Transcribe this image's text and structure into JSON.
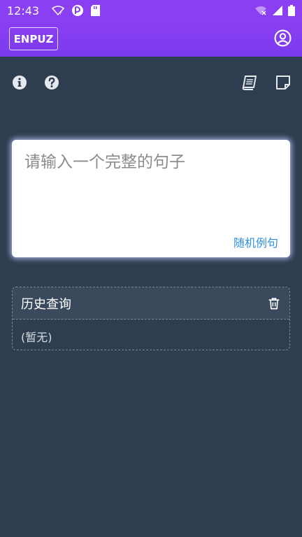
{
  "status_bar": {
    "time": "12:43",
    "icons": [
      "wifi-question-icon",
      "app-notification-icon",
      "sd-card-icon",
      "wifi-off-icon",
      "signal-icon",
      "battery-icon"
    ]
  },
  "app_bar": {
    "logo_text": "ENPUZ",
    "account_icon": "account-circle-icon"
  },
  "toolbar": {
    "icons": [
      "info-icon",
      "help-icon",
      "book-icon",
      "note-icon"
    ]
  },
  "input": {
    "placeholder": "请输入一个完整的句子",
    "value": "",
    "random_label": "随机例句"
  },
  "history": {
    "title": "历史查询",
    "empty_text": "(暂无)"
  },
  "colors": {
    "app_bar": "#8a3ff2",
    "background": "#2e3e50",
    "link": "#2f8fe0"
  }
}
